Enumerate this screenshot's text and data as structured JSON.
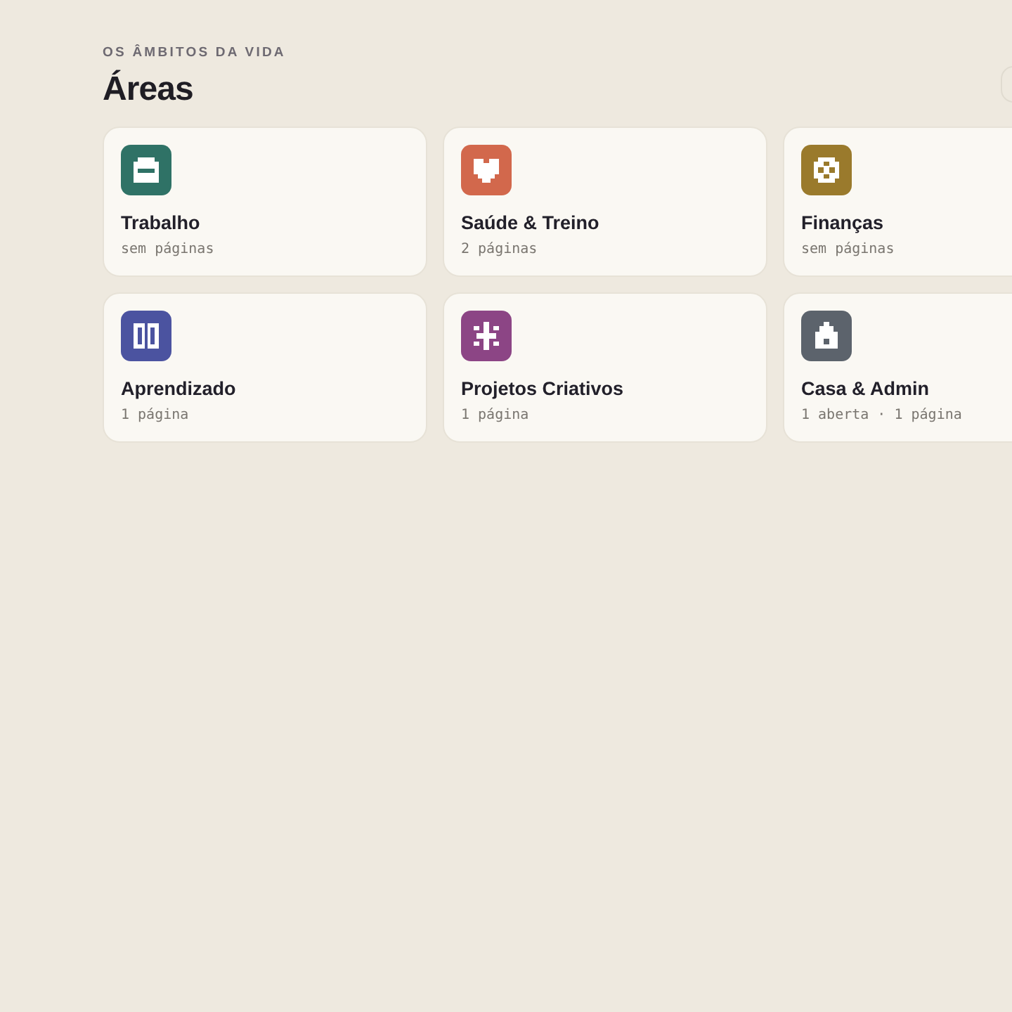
{
  "header": {
    "eyebrow": "OS ÂMBITOS DA VIDA",
    "title": "Áreas"
  },
  "areas": [
    {
      "name": "Trabalho",
      "detail": "sem páginas",
      "color": "#2f7266"
    },
    {
      "name": "Saúde & Treino",
      "detail": "2 páginas",
      "color": "#d2684c"
    },
    {
      "name": "Finanças",
      "detail": "sem páginas",
      "color": "#9a7a2c"
    },
    {
      "name": "Aprendizado",
      "detail": "1 página",
      "color": "#4b53a0"
    },
    {
      "name": "Projetos Criativos",
      "detail": "1 página",
      "color": "#8c4585"
    },
    {
      "name": "Casa & Admin",
      "detail": "1 aberta · 1 página",
      "color": "#5c636c"
    }
  ]
}
